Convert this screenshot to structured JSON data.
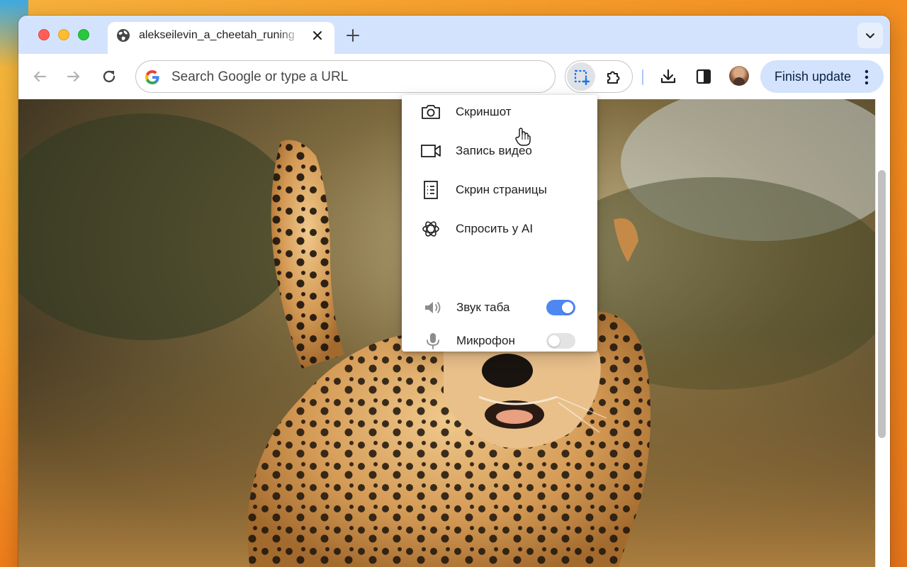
{
  "tab": {
    "title": "alekseilevin_a_cheetah_runing",
    "favicon": "globe-icon"
  },
  "toolbar": {
    "omnibox_placeholder": "Search Google or type a URL",
    "finish_update_label": "Finish update"
  },
  "menu": {
    "items": [
      {
        "label": "Скриншот",
        "icon": "camera-icon"
      },
      {
        "label": "Запись видео",
        "icon": "video-camera-icon"
      },
      {
        "label": "Скрин страницы",
        "icon": "page-document-icon"
      },
      {
        "label": "Спросить у AI",
        "icon": "openai-icon"
      }
    ],
    "toggles": [
      {
        "label": "Звук таба",
        "icon": "speaker-icon",
        "on": true
      },
      {
        "label": "Микрофон",
        "icon": "microphone-icon",
        "on": false
      }
    ]
  },
  "colors": {
    "tabstrip": "#d3e3fd",
    "accent": "#4f87f2",
    "finish_update_bg": "#d3e3fd"
  }
}
